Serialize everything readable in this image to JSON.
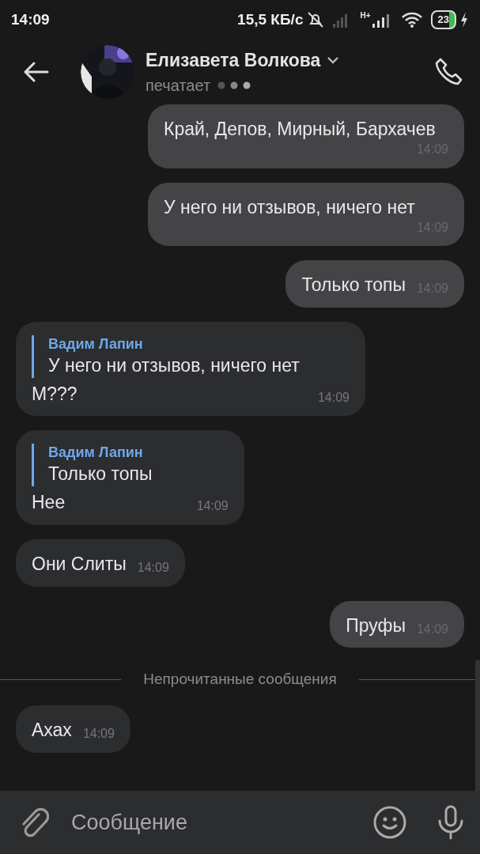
{
  "status_bar": {
    "time": "14:09",
    "speed": "15,5 КБ/с",
    "network": "H+",
    "battery": "23"
  },
  "header": {
    "name": "Елизавета Волкова",
    "status": "печатает"
  },
  "messages": [
    {
      "kind": "out",
      "text": "Край, Депов, Мирный, Бархачев",
      "time": "14:09"
    },
    {
      "kind": "out",
      "text": "У него ни отзывов, ничего нет",
      "time": "14:09"
    },
    {
      "kind": "out",
      "text": "Только топы",
      "time": "14:09"
    },
    {
      "kind": "in",
      "reply": {
        "author": "Вадим Лапин",
        "text": "У него ни отзывов, ничего нет"
      },
      "text": "М???",
      "time": "14:09"
    },
    {
      "kind": "in",
      "reply": {
        "author": "Вадим Лапин",
        "text": "Только топы"
      },
      "text": "Нее",
      "time": "14:09"
    },
    {
      "kind": "in",
      "text": "Они Слиты",
      "time": "14:09"
    },
    {
      "kind": "out",
      "text": "Пруфы",
      "time": "14:09"
    },
    {
      "kind": "divider",
      "text": "Непрочитанные сообщения"
    },
    {
      "kind": "in",
      "text": "Ахах",
      "time": "14:09"
    }
  ],
  "composer": {
    "placeholder": "Сообщение"
  }
}
